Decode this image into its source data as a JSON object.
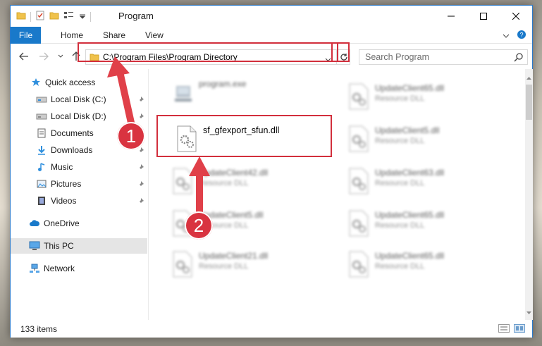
{
  "window": {
    "title": "Program"
  },
  "ribbon": {
    "tabs": [
      "File",
      "Home",
      "Share",
      "View"
    ]
  },
  "nav": {
    "address": "C:\\Program Files\\Program Directory",
    "search_placeholder": "Search Program"
  },
  "sidebar": {
    "items": [
      {
        "label": "Quick access",
        "icon": "star-icon",
        "pinned": false
      },
      {
        "label": "Local Disk (C:)",
        "icon": "drive-icon",
        "pinned": true
      },
      {
        "label": "Local Disk (D:)",
        "icon": "drive-icon",
        "pinned": true
      },
      {
        "label": "Documents",
        "icon": "document-icon",
        "pinned": true
      },
      {
        "label": "Downloads",
        "icon": "download-icon",
        "pinned": true
      },
      {
        "label": "Music",
        "icon": "music-icon",
        "pinned": true
      },
      {
        "label": "Pictures",
        "icon": "pictures-icon",
        "pinned": true
      },
      {
        "label": "Videos",
        "icon": "videos-icon",
        "pinned": true
      },
      {
        "label": "OneDrive",
        "icon": "cloud-icon",
        "pinned": false
      },
      {
        "label": "This PC",
        "icon": "computer-icon",
        "pinned": false,
        "selected": true
      },
      {
        "label": "Network",
        "icon": "network-icon",
        "pinned": false
      }
    ]
  },
  "files": {
    "left": [
      {
        "name": "program.exe",
        "type": ""
      },
      {
        "name": "sf_gfexport_sfun.dll",
        "type": ""
      },
      {
        "name": "UpdateClient42.dll",
        "type": "Resource DLL"
      },
      {
        "name": "UpdateClient5.dll",
        "type": "Resource DLL"
      },
      {
        "name": "UpdateClient21.dll",
        "type": "Resource DLL"
      }
    ],
    "right": [
      {
        "name": "UpdateClient65.dll",
        "type": "Resource DLL"
      },
      {
        "name": "UpdateClient5.dll",
        "type": "Resource DLL"
      },
      {
        "name": "UpdateClient63.dll",
        "type": "Resource DLL"
      },
      {
        "name": "UpdateClient65.dll",
        "type": "Resource DLL"
      },
      {
        "name": "UpdateClient65.dll",
        "type": "Resource DLL"
      }
    ]
  },
  "status": {
    "items_count": "133 items"
  },
  "callouts": {
    "one": "1",
    "two": "2"
  },
  "colors": {
    "accent": "#1979ca",
    "highlight": "#d22f3c",
    "badge": "#d93340"
  }
}
